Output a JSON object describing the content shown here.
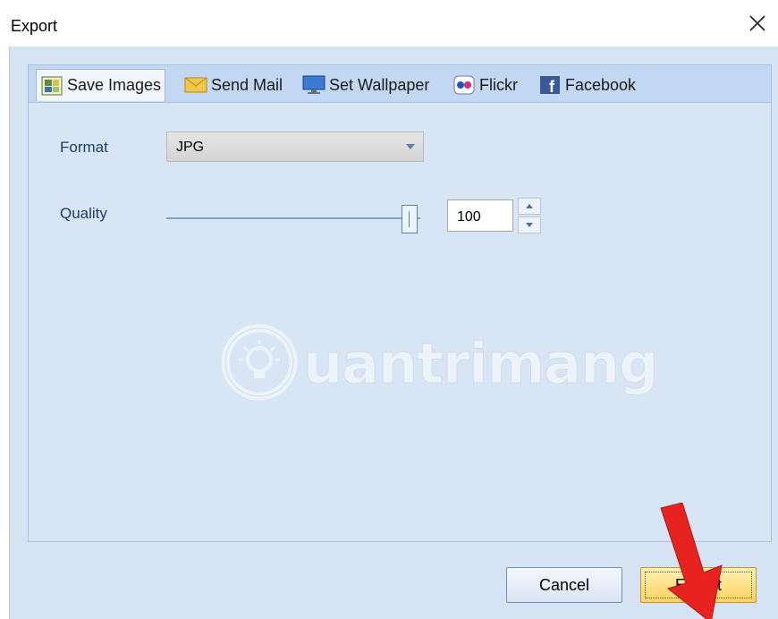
{
  "window": {
    "title": "Export"
  },
  "tabs": [
    {
      "label": "Save Images",
      "icon": "save-images-icon",
      "active": true
    },
    {
      "label": "Send Mail",
      "icon": "mail-envelope-icon",
      "active": false
    },
    {
      "label": "Set Wallpaper",
      "icon": "monitor-icon",
      "active": false
    },
    {
      "label": "Flickr",
      "icon": "flickr-icon",
      "active": false
    },
    {
      "label": "Facebook",
      "icon": "facebook-icon",
      "active": false
    }
  ],
  "format": {
    "label": "Format",
    "value": "JPG"
  },
  "quality": {
    "label": "Quality",
    "value": "100",
    "slider_fraction": 1.0
  },
  "watermark": {
    "text": "uantrimang"
  },
  "buttons": {
    "cancel": "Cancel",
    "export": "Export"
  },
  "colors": {
    "accent_arrow": "#e8231f",
    "export_button": "#ffd35c",
    "panel_bg": "#d7e5f5"
  }
}
